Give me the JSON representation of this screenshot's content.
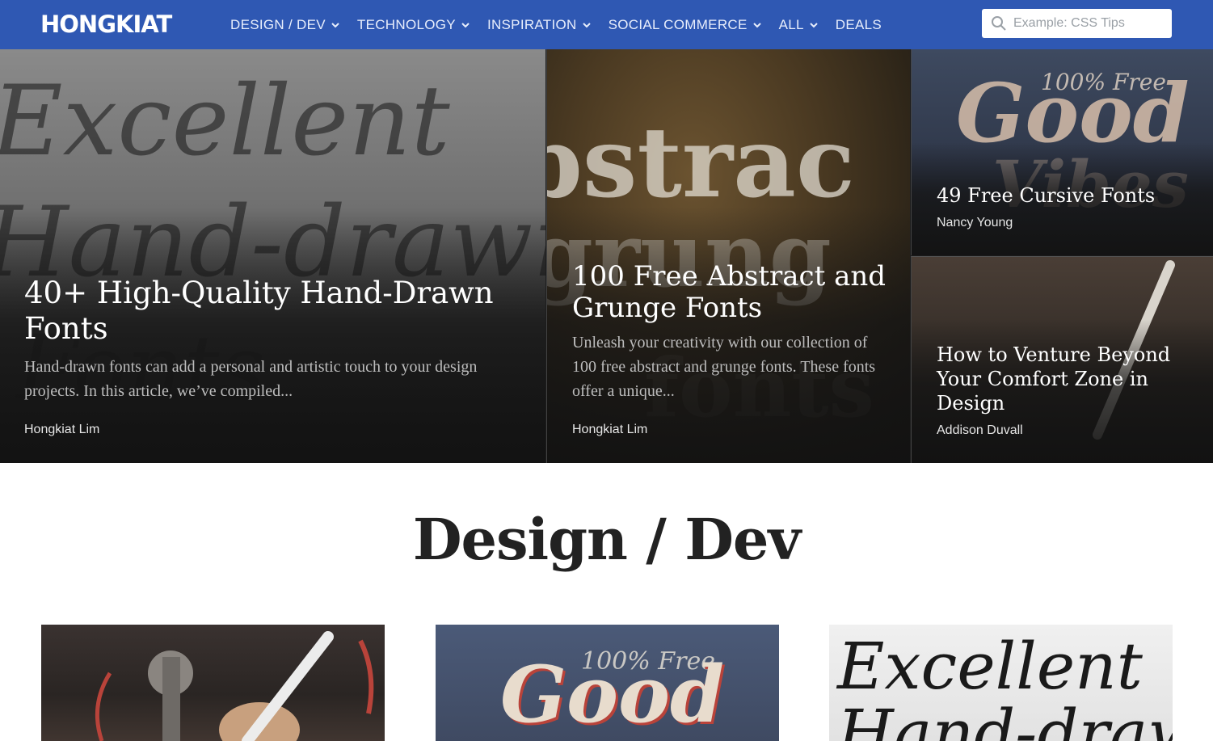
{
  "nav": {
    "logo": "HONGKIAT",
    "menu": [
      {
        "label": "DESIGN / DEV",
        "has_dropdown": true
      },
      {
        "label": "TECHNOLOGY",
        "has_dropdown": true
      },
      {
        "label": "INSPIRATION",
        "has_dropdown": true
      },
      {
        "label": "SOCIAL COMMERCE",
        "has_dropdown": true
      },
      {
        "label": "ALL",
        "has_dropdown": true
      },
      {
        "label": "DEALS",
        "has_dropdown": false
      }
    ],
    "search": {
      "placeholder": "Example: CSS Tips",
      "icon": "search-icon"
    },
    "background": "#2f58b3"
  },
  "hero": {
    "cards": [
      {
        "title": "40+ High-Quality Hand-Drawn Fonts",
        "excerpt": "Hand-drawn fonts can add a personal and artistic touch to your design projects. In this article, we’ve compiled...",
        "author": "Hongkiat Lim",
        "image_text": [
          "Excellent",
          "Hand-drawn",
          "Fonts"
        ]
      },
      {
        "title": "100 Free Abstract and Grunge Fonts",
        "excerpt": "Unleash your creativity with our collection of 100 free abstract and grunge fonts. These fonts offer a unique...",
        "author": "Hongkiat Lim",
        "image_text": [
          "bstrac",
          "grung",
          "fonts"
        ]
      },
      {
        "title": "49 Free Cursive Fonts",
        "author": "Nancy Young",
        "image_text": [
          "100% Free",
          "Good",
          "Vibes"
        ]
      },
      {
        "title": "How to Venture Beyond Your Comfort Zone in Design",
        "author": "Addison Duvall"
      }
    ]
  },
  "section": {
    "title": "Design / Dev",
    "thumbnails": [
      {
        "image_text": []
      },
      {
        "image_text": [
          "100% Free",
          "Good"
        ]
      },
      {
        "image_text": [
          "Excellent",
          "Hand-drawn"
        ]
      }
    ]
  }
}
